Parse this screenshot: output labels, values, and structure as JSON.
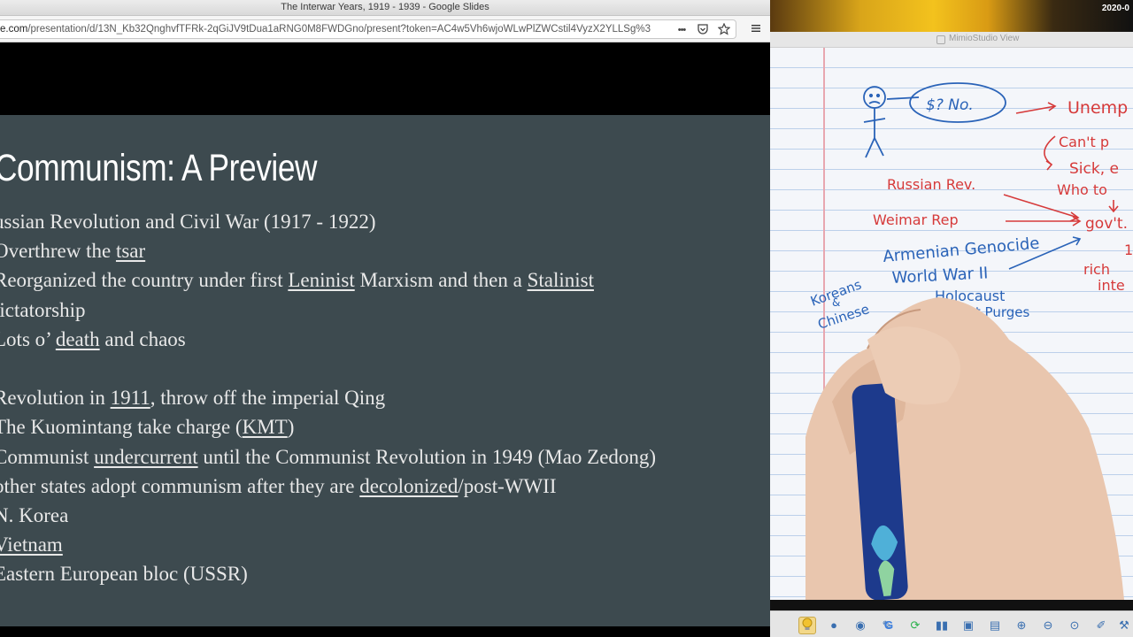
{
  "browser": {
    "window_title": "The Interwar Years, 1919 - 1939 - Google Slides",
    "url_host": "e.com",
    "url_path": "/presentation/d/13N_Kb32QnghvfTFRk-2qGiJV9tDua1aRNG0M8FWDGno/present?token=AC4w5Vh6wjoWLwPlZWCstil4VyzX2YLLSg%3",
    "buttons": {
      "more": "•••",
      "pocket": "pocket-icon",
      "bookmark": "star-icon",
      "menu": "hamburger-menu-icon"
    }
  },
  "slide": {
    "title": "Communism: A Preview",
    "lines": [
      {
        "parts": [
          {
            "text": "ussian Revolution and Civil War (1917 - 1922)"
          }
        ]
      },
      {
        "parts": [
          {
            "text": "Overthrew the "
          },
          {
            "text": "tsar",
            "u": true
          }
        ]
      },
      {
        "parts": [
          {
            "text": "Reorganized the country under first "
          },
          {
            "text": "Leninist",
            "u": true
          },
          {
            "text": " Marxism and then a "
          },
          {
            "text": "Stalinist",
            "u": true
          }
        ]
      },
      {
        "parts": [
          {
            "text": "lictatorship"
          }
        ]
      },
      {
        "parts": [
          {
            "text": "Lots o’ "
          },
          {
            "text": "death",
            "u": true
          },
          {
            "text": " and chaos"
          }
        ]
      },
      {
        "parts": [
          {
            "text": ":"
          }
        ]
      },
      {
        "parts": [
          {
            "text": "Revolution in "
          },
          {
            "text": "1911",
            "u": true
          },
          {
            "text": ", throw off the imperial Qing"
          }
        ]
      },
      {
        "parts": [
          {
            "text": "The Kuomintang take charge ("
          },
          {
            "text": "KMT",
            "u": true
          },
          {
            "text": ")"
          }
        ]
      },
      {
        "parts": [
          {
            "text": "Communist "
          },
          {
            "text": "undercurrent",
            "u": true
          },
          {
            "text": " until the Communist Revolution in 1949 (Mao Zedong)"
          }
        ]
      },
      {
        "parts": [
          {
            "text": "other states adopt communism after they are "
          },
          {
            "text": "decolonized",
            "u": true
          },
          {
            "text": "/post-WWII"
          }
        ]
      },
      {
        "parts": [
          {
            "text": "N. Korea"
          }
        ]
      },
      {
        "parts": [
          {
            "text": "Vietnam",
            "u": true
          }
        ]
      },
      {
        "parts": [
          {
            "text": "Eastern European bloc (USSR)"
          }
        ]
      }
    ]
  },
  "webcam": {
    "timestamp": "2020-0"
  },
  "mimio": {
    "window_title": "MimioStudio View",
    "notes": {
      "money_bubble": "$? No.",
      "unemp": "Unemp",
      "cant": "Can't p",
      "sick": "Sick, e",
      "who_to": "Who to",
      "russian_rev": "Russian Rev.",
      "weimar": "Weimar Rep",
      "govt": "gov't.",
      "armenian": "Armenian Genocide",
      "ww2": "World War II",
      "holocaust": "Holocaust",
      "purges": "Great Purges",
      "koreans": "Koreans",
      "and": "&",
      "chinese": "Chinese",
      "rich": "rich",
      "inte": "inte",
      "one": "1"
    },
    "colors": {
      "blue_ink": "#2a63b8",
      "red_ink": "#d63a3a",
      "paper_line": "#bcd0ea",
      "margin_line": "#e8a7b0"
    },
    "tools": [
      "lightbulb-icon",
      "dot-icon",
      "eye-icon",
      "pen-icon",
      "google-icon",
      "refresh-icon",
      "pause-icon",
      "screen-icon",
      "window-icon",
      "zoom-in-icon",
      "zoom-out-icon",
      "zoom-fit-icon",
      "edit-icon",
      "tools-icon"
    ]
  }
}
